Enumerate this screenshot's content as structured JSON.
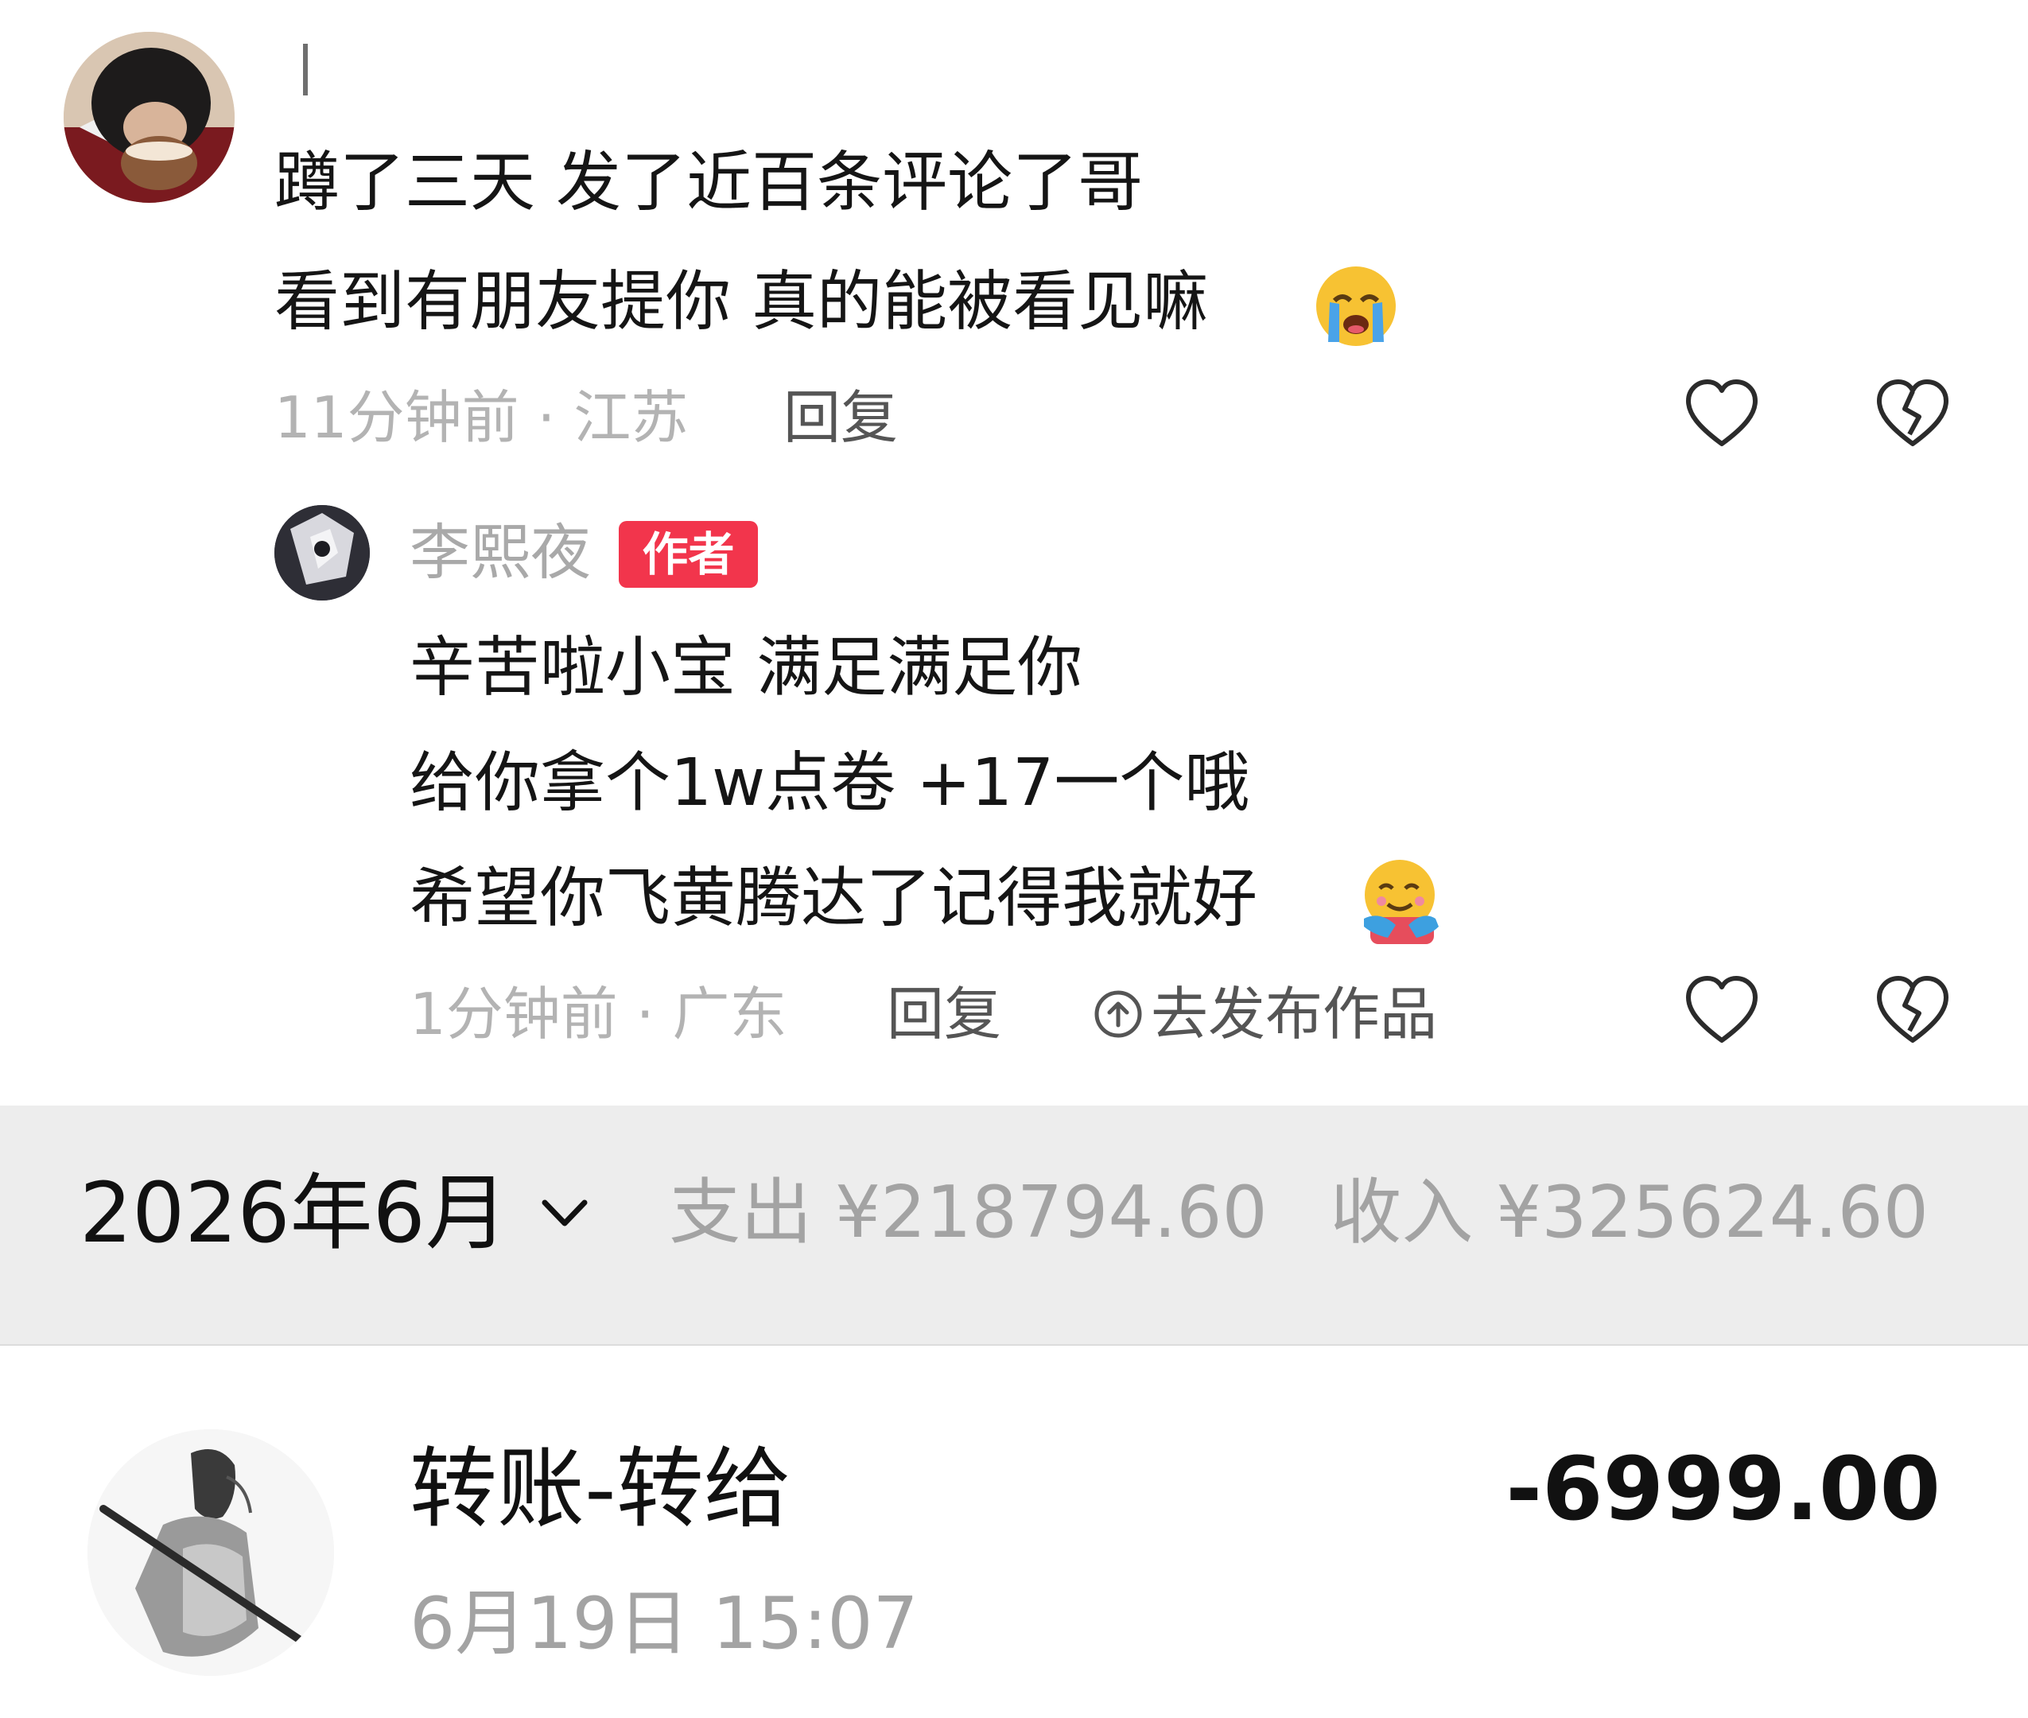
{
  "comment": {
    "lines": [
      "蹲了三天 发了近百条评论了哥",
      "看到有朋友提你 真的能被看见嘛"
    ],
    "emoji": "loudly-crying-face",
    "time_location": "11分钟前 · 江苏",
    "reply_label": "回复"
  },
  "reply": {
    "author_name": "李熙夜",
    "badge": "作者",
    "lines": [
      "辛苦啦小宝 满足满足你",
      "给你拿个1w点卷 +17一个哦",
      "希望你飞黄腾达了记得我就好"
    ],
    "emoji": "hugging-face",
    "time_location": "1分钟前 · 广东",
    "reply_label": "回复",
    "publish_label": "去发布作品"
  },
  "bill": {
    "month_label": "2026年6月",
    "expense_label": "支出 ¥218794.60",
    "income_label": "收入 ¥325624.60",
    "transaction": {
      "title": "转账-转给",
      "amount": "-6999.00",
      "time": "6月19日 15:07"
    }
  },
  "colors": {
    "badge_red": "#f2354c",
    "muted_gray": "#a3a3a3",
    "month_bar_bg": "#ededed"
  }
}
